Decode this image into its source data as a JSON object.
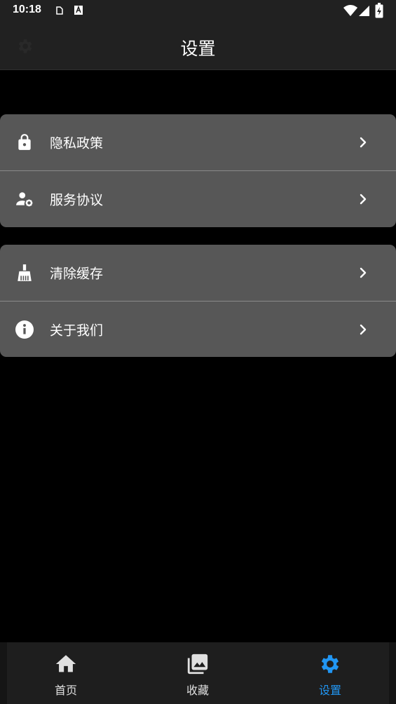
{
  "status_bar": {
    "time": "10:18"
  },
  "app_bar": {
    "title": "设置",
    "left_icon": "gear-icon"
  },
  "groups": [
    {
      "items": [
        {
          "label": "隐私政策",
          "icon": "lock-icon"
        },
        {
          "label": "服务协议",
          "icon": "user-gear-icon"
        }
      ]
    },
    {
      "items": [
        {
          "label": "清除缓存",
          "icon": "broom-icon"
        },
        {
          "label": "关于我们",
          "icon": "info-icon"
        }
      ]
    }
  ],
  "bottom_nav": {
    "items": [
      {
        "label": "首页",
        "icon": "home-icon",
        "active": false
      },
      {
        "label": "收藏",
        "icon": "photo-library-icon",
        "active": false
      },
      {
        "label": "设置",
        "icon": "settings-icon",
        "active": true
      }
    ]
  },
  "colors": {
    "background": "#000000",
    "app_bar": "#212121",
    "card": "#575757",
    "divider": "#8a8a8a",
    "accent": "#2196f3",
    "nav_bar": "#1e1e1e"
  }
}
